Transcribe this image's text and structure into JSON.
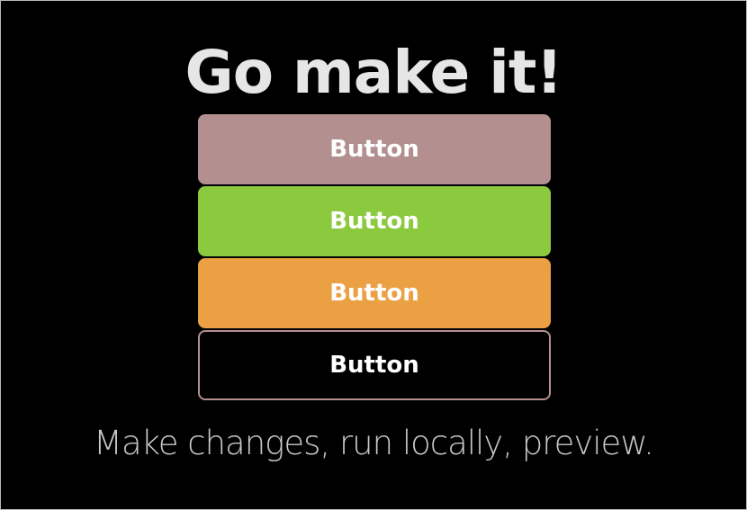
{
  "page": {
    "title": "Go make it!",
    "subtitle": "Make changes, run locally, preview."
  },
  "buttons": [
    {
      "label": "Button",
      "color": "#b38f8f",
      "style": "filled"
    },
    {
      "label": "Button",
      "color": "#8bc93e",
      "style": "filled"
    },
    {
      "label": "Button",
      "color": "#eba043",
      "style": "filled"
    },
    {
      "label": "Button",
      "color": "#b38f8f",
      "style": "outline"
    }
  ],
  "colors": {
    "background": "#000000",
    "title": "#e6e6e6",
    "subtitle": "#c8c8c8",
    "button_text": "#ffffff"
  }
}
